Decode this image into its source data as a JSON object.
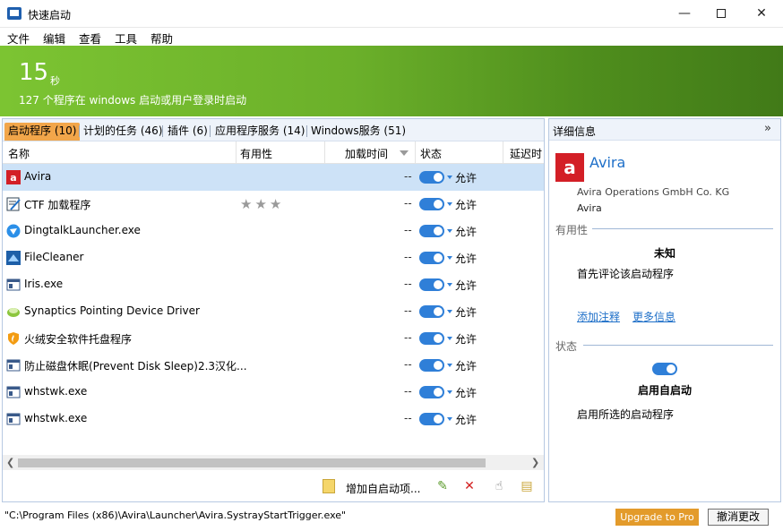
{
  "window": {
    "title": "快速启动"
  },
  "menu": [
    "文件",
    "编辑",
    "查看",
    "工具",
    "帮助"
  ],
  "banner": {
    "seconds": "15",
    "unit": "秒",
    "subtitle": "127 个程序在 windows 启动或用户登录时启动"
  },
  "tabs": [
    {
      "label": "启动程序 (10)",
      "active": true
    },
    {
      "label": "计划的任务 (46)"
    },
    {
      "label": "插件 (6)"
    },
    {
      "label": "应用程序服务 (14)"
    },
    {
      "label": "Windows服务 (51)"
    }
  ],
  "columns": {
    "name": "名称",
    "usefulness": "有用性",
    "load_time": "加载时间",
    "status": "状态",
    "delay": "延迟时"
  },
  "rows": [
    {
      "name": "Avira",
      "icon": "avira-icon",
      "load": "--",
      "status": "允许",
      "selected": true
    },
    {
      "name": "CTF 加载程序",
      "icon": "notepad-icon",
      "load": "--",
      "status": "允许",
      "stars": "★★★",
      "rating_stars": 3
    },
    {
      "name": "DingtalkLauncher.exe",
      "icon": "dingtalk-icon",
      "load": "--",
      "status": "允许"
    },
    {
      "name": "FileCleaner",
      "icon": "filecleaner-icon",
      "load": "--",
      "status": "允许"
    },
    {
      "name": "Iris.exe",
      "icon": "window-icon",
      "load": "--",
      "status": "允许"
    },
    {
      "name": "Synaptics Pointing Device Driver",
      "icon": "synaptics-icon",
      "load": "--",
      "status": "允许"
    },
    {
      "name": "火绒安全软件托盘程序",
      "icon": "huorong-shield-icon",
      "load": "--",
      "status": "允许"
    },
    {
      "name": "防止磁盘休眠(Prevent Disk Sleep)2.3汉化...",
      "icon": "window-icon",
      "load": "--",
      "status": "允许"
    },
    {
      "name": "whstwk.exe",
      "icon": "window-icon",
      "load": "--",
      "status": "允许"
    },
    {
      "name": "whstwk.exe",
      "icon": "window-icon",
      "load": "--",
      "status": "允许"
    }
  ],
  "toolbar": {
    "add_label": "增加自启动项..."
  },
  "details": {
    "title": "详细信息",
    "collapse_glyph": "»",
    "logo_letter": "a",
    "app_name": "Avira",
    "company": "Avira Operations GmbH  Co. KG",
    "product": "Avira",
    "usefulness_label": "有用性",
    "usefulness_value": "未知",
    "first_review": "首先评论该启动程序",
    "add_comment": "添加注释",
    "more_info": "更多信息",
    "status_label": "状态",
    "status_value": "启用自启动",
    "status_desc": "启用所选的启动程序"
  },
  "statusbar": {
    "path": "\"C:\\Program Files (x86)\\Avira\\Launcher\\Avira.SystrayStartTrigger.exe\"",
    "upgrade": "Upgrade to Pro",
    "cancel": "撤消更改"
  },
  "colors": {
    "banner_start": "#7cc432",
    "banner_end": "#417a18",
    "active_tab": "#f2a64a",
    "toggle": "#2f7fd8",
    "link": "#1e6fc8",
    "upgrade": "#e39b2b"
  }
}
